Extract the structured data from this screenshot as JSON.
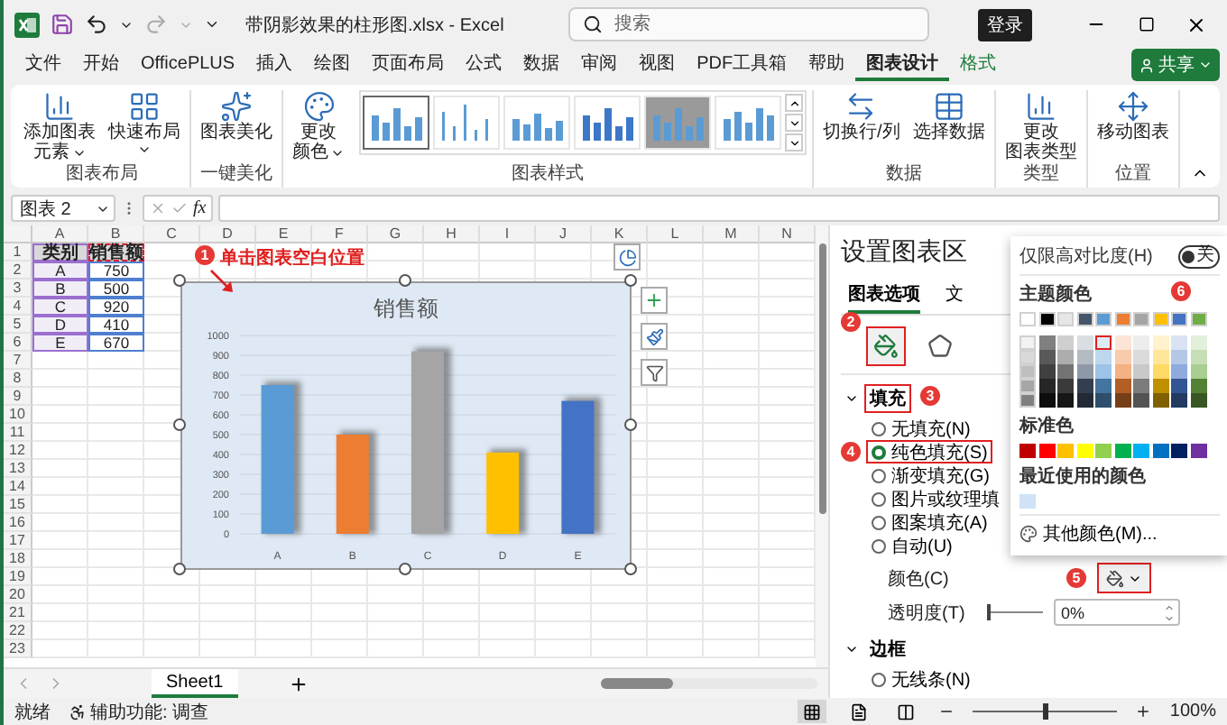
{
  "window": {
    "title": "带阴影效果的柱形图.xlsx - Excel",
    "search_placeholder": "搜索",
    "sign_in": "登录"
  },
  "menu_tabs": [
    {
      "label": "文件",
      "selected": false,
      "kind": "standard"
    },
    {
      "label": "开始",
      "selected": false,
      "kind": "standard"
    },
    {
      "label": "OfficePLUS",
      "selected": false,
      "kind": "standard"
    },
    {
      "label": "插入",
      "selected": false,
      "kind": "standard"
    },
    {
      "label": "绘图",
      "selected": false,
      "kind": "standard"
    },
    {
      "label": "页面布局",
      "selected": false,
      "kind": "standard"
    },
    {
      "label": "公式",
      "selected": false,
      "kind": "standard"
    },
    {
      "label": "数据",
      "selected": false,
      "kind": "standard"
    },
    {
      "label": "审阅",
      "selected": false,
      "kind": "standard"
    },
    {
      "label": "视图",
      "selected": false,
      "kind": "standard"
    },
    {
      "label": "PDF工具箱",
      "selected": false,
      "kind": "standard"
    },
    {
      "label": "帮助",
      "selected": false,
      "kind": "standard"
    },
    {
      "label": "图表设计",
      "selected": true,
      "kind": "contextual"
    },
    {
      "label": "格式",
      "selected": false,
      "kind": "contextual"
    }
  ],
  "share": "共享",
  "ribbon_groups": [
    {
      "label": "图表布局",
      "commands": [
        {
          "lines": [
            "添加图表",
            "元素"
          ],
          "dropdown": true
        },
        {
          "lines": [
            "快速布局"
          ],
          "dropdown": true
        }
      ]
    },
    {
      "label": "一键美化",
      "commands": [
        {
          "lines": [
            "图表美化"
          ],
          "dropdown": false
        }
      ]
    },
    {
      "label": "图表样式",
      "commands": [
        {
          "lines": [
            "更改",
            "颜色"
          ],
          "dropdown": true
        }
      ],
      "styles": [
        {
          "selected": true
        },
        {
          "selected": false
        },
        {
          "selected": false
        },
        {
          "selected": false
        },
        {
          "selected": false
        },
        {
          "selected": false
        }
      ]
    },
    {
      "label": "数据",
      "commands": [
        {
          "lines": [
            "切换行/列"
          ],
          "dropdown": false
        },
        {
          "lines": [
            "选择数据"
          ],
          "dropdown": false
        }
      ]
    },
    {
      "label": "类型",
      "commands": [
        {
          "lines": [
            "更改",
            "图表类型"
          ],
          "dropdown": false
        }
      ]
    },
    {
      "label": "位置",
      "commands": [
        {
          "lines": [
            "移动图表"
          ],
          "dropdown": false
        }
      ]
    }
  ],
  "formula_bar": {
    "name_box": "图表 2",
    "function_label": "fx"
  },
  "sheet": {
    "columns": [
      "A",
      "B",
      "C",
      "D",
      "E",
      "F",
      "G",
      "H",
      "I",
      "J",
      "K",
      "L",
      "M",
      "N"
    ],
    "row_numbers": [
      "1",
      "2",
      "3",
      "4",
      "5",
      "6",
      "7",
      "8",
      "9",
      "10",
      "11",
      "12",
      "13",
      "14",
      "15",
      "16",
      "17",
      "18",
      "19",
      "20",
      "21",
      "22",
      "23"
    ],
    "cells": [
      [
        "类别",
        "销售额"
      ],
      [
        "A",
        "750"
      ],
      [
        "B",
        "500"
      ],
      [
        "C",
        "920"
      ],
      [
        "D",
        "410"
      ],
      [
        "E",
        "670"
      ]
    ]
  },
  "chart": {
    "callout": {
      "number": "1",
      "text": "单击图表空白位置"
    },
    "chart_data": {
      "type": "bar",
      "title": "销售额",
      "categories": [
        "A",
        "B",
        "C",
        "D",
        "E"
      ],
      "values": [
        750,
        500,
        920,
        410,
        670
      ],
      "ylim": [
        0,
        1000
      ],
      "grid": true,
      "yticks": [
        {
          "value": 0,
          "label": "0"
        },
        {
          "value": 100,
          "label": "100"
        },
        {
          "value": 200,
          "label": "200"
        },
        {
          "value": 300,
          "label": "300"
        },
        {
          "value": 400,
          "label": "400"
        },
        {
          "value": 500,
          "label": "500"
        },
        {
          "value": 600,
          "label": "600"
        },
        {
          "value": 700,
          "label": "700"
        },
        {
          "value": 800,
          "label": "800"
        },
        {
          "value": 900,
          "label": "900"
        },
        {
          "value": 1000,
          "label": "1000"
        }
      ]
    }
  },
  "format_pane": {
    "title": "设置图表区",
    "tabs": [
      {
        "label": "图表选项",
        "selected": true
      },
      {
        "label": "文",
        "selected": false
      }
    ],
    "category_icons": [
      {
        "selected": true,
        "highlighted": true,
        "badge": "2"
      },
      {
        "selected": false,
        "highlighted": false
      }
    ],
    "fill": {
      "label": "填充",
      "expanded": true,
      "highlighted": true,
      "badge": "3",
      "options": [
        {
          "label": "无填充(N)",
          "selected": false,
          "highlighted": false
        },
        {
          "label": "纯色填充(S)",
          "selected": true,
          "highlighted": true,
          "badge": "4"
        },
        {
          "label": "渐变填充(G)",
          "selected": false,
          "highlighted": false
        },
        {
          "label": "图片或纹理填",
          "selected": false,
          "highlighted": false
        },
        {
          "label": "图案填充(A)",
          "selected": false,
          "highlighted": false
        },
        {
          "label": "自动(U)",
          "selected": false,
          "highlighted": false
        }
      ],
      "color": {
        "label": "颜色(C)",
        "highlighted": true,
        "badge": "5"
      },
      "transparency": {
        "label": "透明度(T)",
        "level": 0,
        "reading": "0%"
      }
    },
    "border": {
      "label": "边框",
      "expanded": true,
      "options": [
        {
          "label": "无线条(N)",
          "selected": false
        }
      ]
    }
  },
  "color_popup": {
    "contrast_toggle": {
      "label": "仅限高对比度(H)",
      "on": false,
      "state_text": "关"
    },
    "theme_label": "主题颜色",
    "theme_colors": [
      {
        "color": "#ffffff",
        "shades": [
          {
            "selected": false
          },
          {
            "selected": false
          },
          {
            "selected": false
          },
          {
            "selected": false
          },
          {
            "selected": false
          }
        ]
      },
      {
        "color": "#000000",
        "shades": [
          {
            "selected": false
          },
          {
            "selected": false
          },
          {
            "selected": false
          },
          {
            "selected": false
          },
          {
            "selected": false
          }
        ]
      },
      {
        "color": "#e7e6e6",
        "shades": [
          {
            "selected": false
          },
          {
            "selected": false
          },
          {
            "selected": false
          },
          {
            "selected": false
          },
          {
            "selected": false
          }
        ]
      },
      {
        "color": "#44546a",
        "shades": [
          {
            "selected": false
          },
          {
            "selected": false
          },
          {
            "selected": false
          },
          {
            "selected": false
          },
          {
            "selected": false
          }
        ]
      },
      {
        "color": "#5b9bd5",
        "shades": [
          {
            "selected": true
          },
          {
            "selected": false
          },
          {
            "selected": false
          },
          {
            "selected": false
          },
          {
            "selected": false
          }
        ]
      },
      {
        "color": "#ed7d31",
        "shades": [
          {
            "selected": false
          },
          {
            "selected": false
          },
          {
            "selected": false
          },
          {
            "selected": false
          },
          {
            "selected": false
          }
        ]
      },
      {
        "color": "#a5a5a5",
        "shades": [
          {
            "selected": false
          },
          {
            "selected": false
          },
          {
            "selected": false
          },
          {
            "selected": false
          },
          {
            "selected": false
          }
        ]
      },
      {
        "color": "#ffc000",
        "shades": [
          {
            "selected": false
          },
          {
            "selected": false
          },
          {
            "selected": false
          },
          {
            "selected": false
          },
          {
            "selected": false
          }
        ]
      },
      {
        "color": "#4472c4",
        "shades": [
          {
            "selected": false
          },
          {
            "selected": false
          },
          {
            "selected": false
          },
          {
            "selected": false
          },
          {
            "selected": false
          }
        ]
      },
      {
        "color": "#70ad47",
        "shades": [
          {
            "selected": false
          },
          {
            "selected": false
          },
          {
            "selected": false
          },
          {
            "selected": false
          },
          {
            "selected": false
          }
        ]
      }
    ],
    "shade_badge": "6",
    "standard_label": "标准色",
    "standard_colors": [
      {
        "color": "#c00000"
      },
      {
        "color": "#ff0000"
      },
      {
        "color": "#ffc000"
      },
      {
        "color": "#ffff00"
      },
      {
        "color": "#92d050"
      },
      {
        "color": "#00b050"
      },
      {
        "color": "#00b0f0"
      },
      {
        "color": "#0070c0"
      },
      {
        "color": "#002060"
      },
      {
        "color": "#7030a0"
      }
    ],
    "recent_label": "最近使用的颜色",
    "recent_colors": [
      {
        "color": "#cfe2f6"
      }
    ],
    "more_colors": "其他颜色(M)..."
  },
  "sheet_tabs": [
    {
      "label": "Sheet1",
      "selected": true
    }
  ],
  "status_bar": {
    "status": "就绪",
    "accessibility": "辅助功能: 调查",
    "views": [
      {
        "selected": true
      },
      {
        "selected": false
      },
      {
        "selected": false
      }
    ],
    "zoom": {
      "level": 0.5,
      "reading": "100%"
    }
  }
}
